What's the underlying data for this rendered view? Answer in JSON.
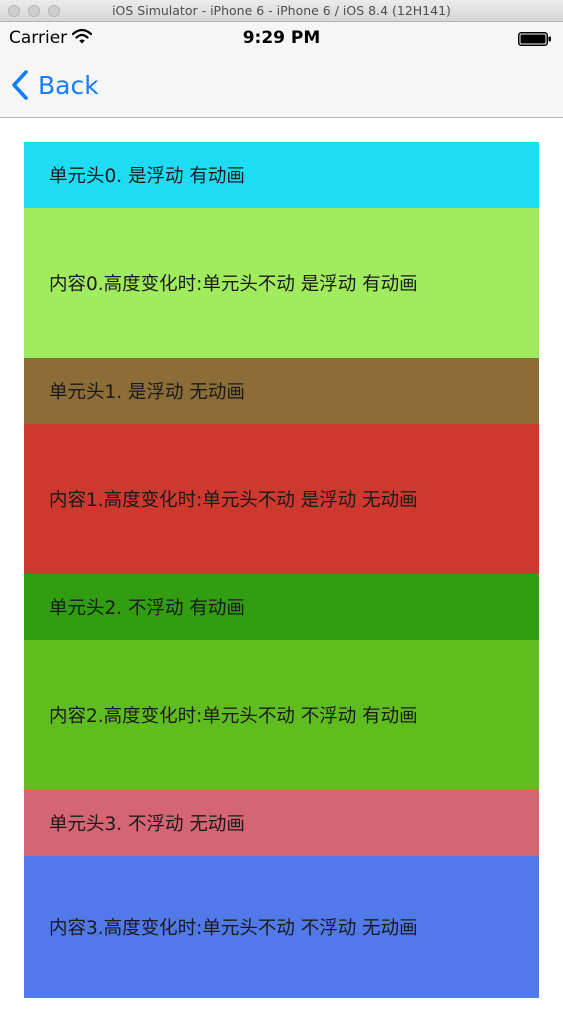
{
  "window": {
    "title": "iOS Simulator - iPhone 6 - iPhone 6 / iOS 8.4 (12H141)"
  },
  "status_bar": {
    "carrier": "Carrier",
    "time": "9:29 PM"
  },
  "nav": {
    "back_label": "Back",
    "accent_color": "#157efb"
  },
  "sections": [
    {
      "header": "单元头0. 是浮动 有动画",
      "header_color": "#1edcf3",
      "body": "内容0.高度变化时:单元头不动 是浮动 有动画",
      "body_color": "#a1ec5e"
    },
    {
      "header": "单元头1. 是浮动 无动画",
      "header_color": "#8c6d37",
      "body": "内容1.高度变化时:单元头不动 是浮动 无动画",
      "body_color": "#cd392e"
    },
    {
      "header": "单元头2. 不浮动 有动画",
      "header_color": "#319d11",
      "body": "内容2.高度变化时:单元头不动 不浮动 有动画",
      "body_color": "#60bd20"
    },
    {
      "header": "单元头3. 不浮动 无动画",
      "header_color": "#d56572",
      "body": "内容3.高度变化时:单元头不动 不浮动 无动画",
      "body_color": "#5179ea"
    }
  ]
}
